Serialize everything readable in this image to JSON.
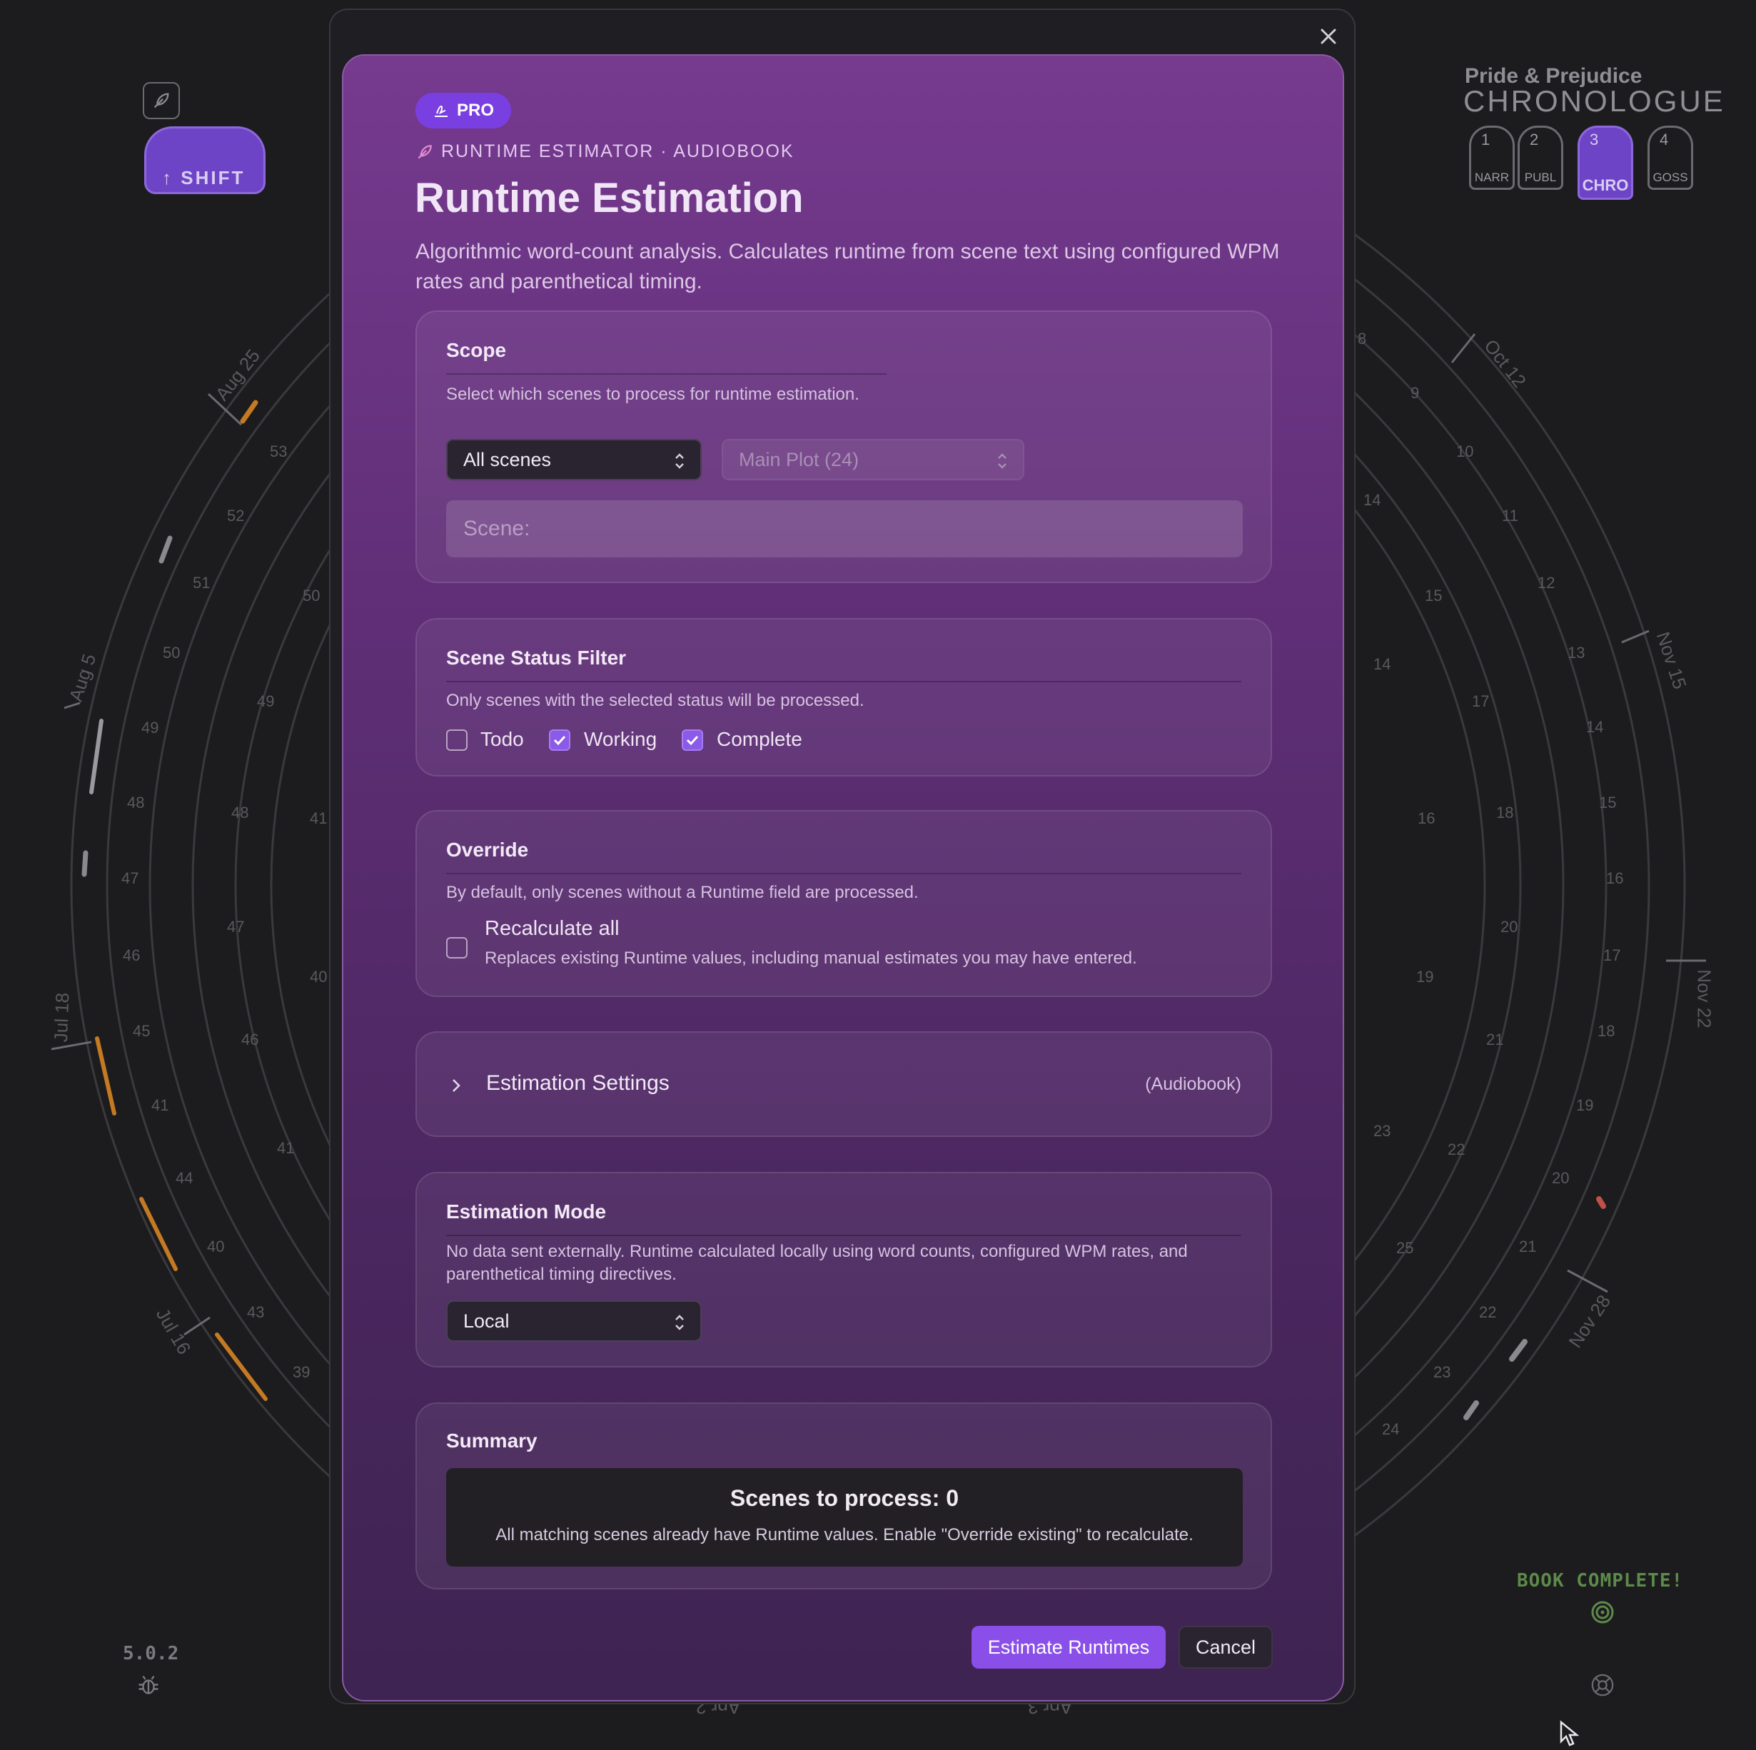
{
  "background": {
    "version": "5.0.2",
    "book_status": "BOOK COMPLETE!",
    "brand": {
      "title": "Pride & Prejudice",
      "subtitle": "CHRONOLOGUE"
    },
    "shift_key": "↑ SHIFT",
    "modes": [
      {
        "num": "1",
        "label": "NARR",
        "active": false
      },
      {
        "num": "2",
        "label": "PUBL",
        "active": false
      },
      {
        "num": "3",
        "label": "CHRO",
        "active": true
      },
      {
        "num": "4",
        "label": "GOSS",
        "active": false
      }
    ],
    "date_labels": [
      "Aug 25",
      "Aug 5",
      "Jul 18",
      "Jul 16",
      "Oct 12",
      "Nov 15",
      "Nov 22",
      "Nov 28",
      "Apr 2",
      "Apr 3"
    ],
    "left_numbers": [
      "53",
      "52",
      "51",
      "50",
      "49",
      "48",
      "47",
      "46",
      "45",
      "41",
      "44",
      "40",
      "43",
      "39",
      "50",
      "49",
      "48",
      "47",
      "46",
      "41",
      "41",
      "40"
    ],
    "right_numbers": [
      "8",
      "9",
      "10",
      "11",
      "12",
      "13",
      "14",
      "15",
      "16",
      "17",
      "18",
      "19",
      "20",
      "21",
      "22",
      "23",
      "24",
      "14",
      "15",
      "14",
      "17",
      "16",
      "18",
      "20",
      "19",
      "21",
      "22",
      "23",
      "25"
    ]
  },
  "modal": {
    "badge": "PRO",
    "eyebrow": "RUNTIME ESTIMATOR · AUDIOBOOK",
    "title": "Runtime Estimation",
    "description": "Algorithmic word-count analysis. Calculates runtime from scene text using configured WPM rates and parenthetical timing.",
    "scope": {
      "heading": "Scope",
      "description": "Select which scenes to process for runtime estimation.",
      "scope_select": "All scenes",
      "plot_select": "Main Plot (24)",
      "scene_placeholder": "Scene:"
    },
    "status_filter": {
      "heading": "Scene Status Filter",
      "description": "Only scenes with the selected status will be processed.",
      "options": [
        {
          "label": "Todo",
          "checked": false
        },
        {
          "label": "Working",
          "checked": true
        },
        {
          "label": "Complete",
          "checked": true
        }
      ]
    },
    "override": {
      "heading": "Override",
      "description": "By default, only scenes without a Runtime field are processed.",
      "recalc_label": "Recalculate all",
      "recalc_desc": "Replaces existing Runtime values, including manual estimates you may have entered.",
      "recalc_checked": false
    },
    "settings": {
      "heading": "Estimation Settings",
      "tag": "(Audiobook)"
    },
    "mode": {
      "heading": "Estimation Mode",
      "description": "No data sent externally. Runtime calculated locally using word counts, configured WPM rates, and parenthetical timing directives.",
      "select": "Local"
    },
    "summary": {
      "heading": "Summary",
      "title": "Scenes to process: 0",
      "subtitle": "All matching scenes already have Runtime values. Enable \"Override existing\" to recalculate."
    },
    "buttons": {
      "primary": "Estimate Runtimes",
      "cancel": "Cancel"
    }
  }
}
